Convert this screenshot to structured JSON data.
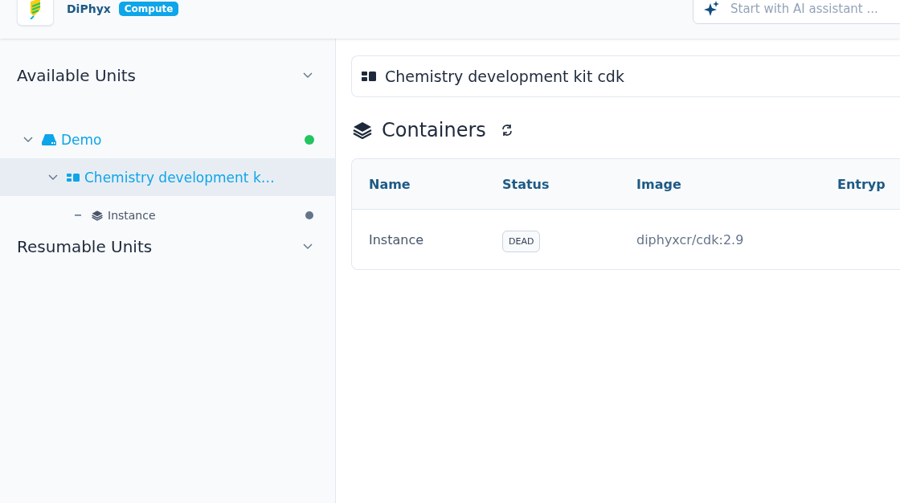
{
  "header": {
    "brand": "DiPhyx",
    "badge": "Compute",
    "assistant": {
      "placeholder": "Start with AI assistant ..."
    }
  },
  "sidebar": {
    "sections": [
      {
        "title": "Available Units",
        "items": [
          {
            "label": "Demo",
            "kind": "unit",
            "expanded": true,
            "selected": false,
            "color": "#22c55e",
            "children": [
              {
                "label": "Chemistry development k…",
                "kind": "app",
                "expanded": true,
                "selected": true,
                "children": [
                  {
                    "label": "Instance",
                    "kind": "instance",
                    "selected": false,
                    "color": "#64748b"
                  }
                ]
              }
            ]
          }
        ]
      },
      {
        "title": "Resumable Units"
      }
    ]
  },
  "main": {
    "app_title": "Chemistry development kit cdk",
    "section_title": "Containers",
    "table": {
      "columns": [
        "Name",
        "Status",
        "Image",
        "Entryp"
      ],
      "rows": [
        {
          "name": "Instance",
          "status": "DEAD",
          "image": "diphyxcr/cdk:2.9"
        }
      ]
    }
  }
}
